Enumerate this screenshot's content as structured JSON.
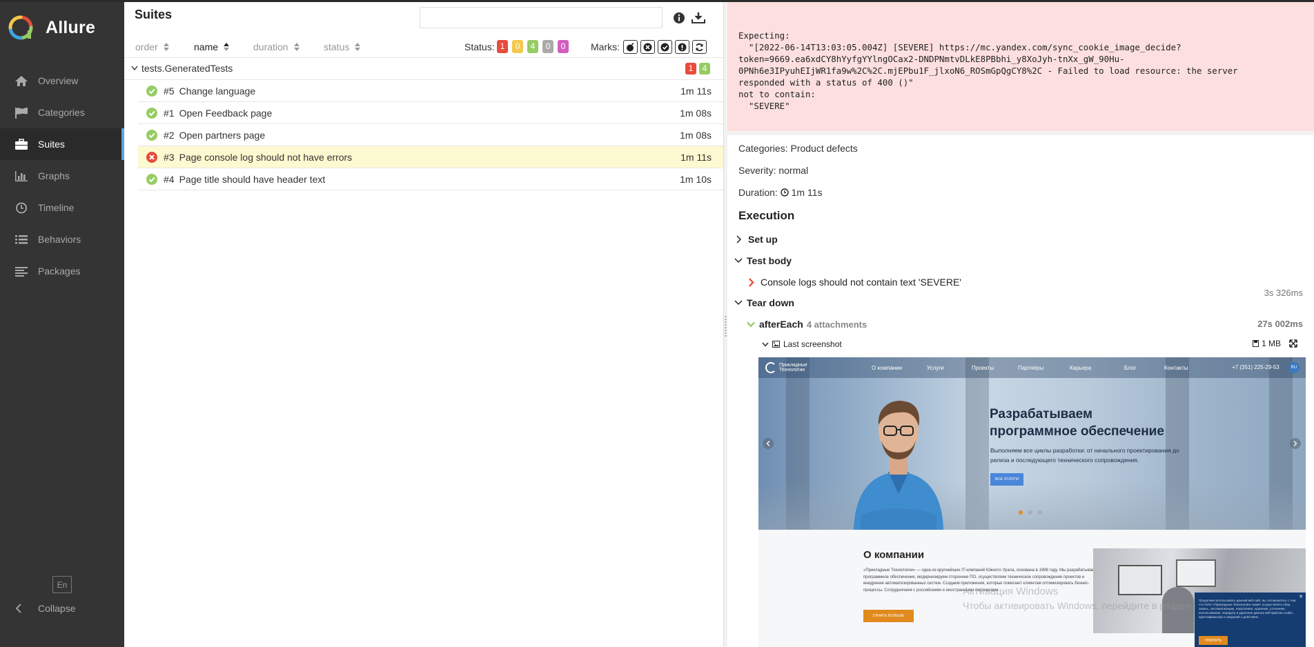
{
  "sidebar": {
    "brand": "Allure",
    "items": [
      {
        "label": "Overview"
      },
      {
        "label": "Categories"
      },
      {
        "label": "Suites"
      },
      {
        "label": "Graphs"
      },
      {
        "label": "Timeline"
      },
      {
        "label": "Behaviors"
      },
      {
        "label": "Packages"
      }
    ],
    "lang": "En",
    "collapse": "Collapse"
  },
  "suites": {
    "title": "Suites",
    "search_value": "",
    "sort": {
      "order": "order",
      "name": "name",
      "duration": "duration",
      "status": "status"
    },
    "status_label": "Status:",
    "status_counts": {
      "failed": "1",
      "broken": "0",
      "passed": "4",
      "skipped": "0",
      "unknown": "0"
    },
    "marks_label": "Marks:",
    "group": {
      "name": "tests.GeneratedTests",
      "failed": "1",
      "passed": "4"
    },
    "tests": [
      {
        "num": "#5",
        "name": "Change language",
        "duration": "1m 11s",
        "status": "passed"
      },
      {
        "num": "#1",
        "name": "Open Feedback page",
        "duration": "1m 08s",
        "status": "passed"
      },
      {
        "num": "#2",
        "name": "Open partners page",
        "duration": "1m 08s",
        "status": "passed"
      },
      {
        "num": "#3",
        "name": "Page console log should not have errors",
        "duration": "1m 11s",
        "status": "failed"
      },
      {
        "num": "#4",
        "name": "Page title should have header text",
        "duration": "1m 10s",
        "status": "passed"
      }
    ]
  },
  "details": {
    "error": "Expecting:\n  \"[2022-06-14T13:03:05.004Z] [SEVERE] https://mc.yandex.com/sync_cookie_image_decide?\ntoken=9669.ea6xdCY8hYyfgYYlngOCax2-DNDPNmtvDLkE8PBbhi_y8XoJyh-tnXx_gW_90Hu-\n0PNh6e3IPyuhEIjWR1fa9w%2C%2C.mjEPbu1F_jlxoN6_ROSmGpQgCY8%2C - Failed to load resource: the server\nresponded with a status of 400 ()\"\nnot to contain:\n  \"SEVERE\"",
    "categories_label": "Categories:",
    "categories_value": "Product defects",
    "severity_label": "Severity:",
    "severity_value": "normal",
    "duration_label": "Duration:",
    "duration_value": "1m 11s",
    "execution_title": "Execution",
    "setup": "Set up",
    "test_body": "Test body",
    "body_step": "Console logs should not contain text 'SEVERE'",
    "body_step_time": "3s 326ms",
    "teardown": "Tear down",
    "after_each": "afterEach",
    "attachments_count": "4 attachments",
    "after_each_time": "27s 002ms",
    "attachment_name": "Last screenshot",
    "attachment_size": "1 MB"
  },
  "screenshot": {
    "logo_line1": "Прикладные",
    "logo_line2": "Технологии",
    "nav": [
      "О компании",
      "Услуги",
      "Проекты",
      "Партнёры",
      "Карьера",
      "Блог",
      "Контакты"
    ],
    "phone": "+7 (351) 225-29-53",
    "lang": "RU",
    "hero_line1": "Разрабатываем",
    "hero_line2": "программное обеспечение",
    "hero_sub": "Выполняем все циклы разработки: от начального проектирования до релиза и последующего технического сопровождения.",
    "hero_btn": "ВСЕ УСЛУГИ",
    "about_title": "О компании",
    "about_text": "«Прикладные Технологии» — одна из крупнейших IT-компаний Южного Урала, основана в 1998 году. Мы разрабатываем программное обеспечение, модернизируем стороннее ПО, осуществляем техническое сопровождение проектов и внедрение автоматизированных систем. Создаем приложения, которые помогают клиентам оптимизировать бизнес-процессы. Сотрудничаем с российскими и иностранными партнерами.",
    "about_btn": "УЗНАТЬ БОЛЬШЕ",
    "cookie_text": "Продолжая использовать данный веб-сайт, вы соглашаетесь с тем, что ООО «Прикладные Технологии» может осуществлять сбор, запись, систематизацию, накопление, хранение, уточнение, использование, передачу и удаление данных веб-файлов cookie, идентификатора и сведений о действиях",
    "cookie_btn": "ПРИНЯТЬ",
    "watermark_1": "Активация Windows",
    "watermark_2": "Чтобы активировать Windows, перейдите в раздел"
  },
  "colors": {
    "failed": "#e74c3c",
    "broken": "#f4c84a",
    "passed": "#97cc64",
    "skipped": "#aaaaaa",
    "unknown": "#d35ebe",
    "sidebar_bg": "#343434",
    "active_accent": "#5fa2dd"
  }
}
